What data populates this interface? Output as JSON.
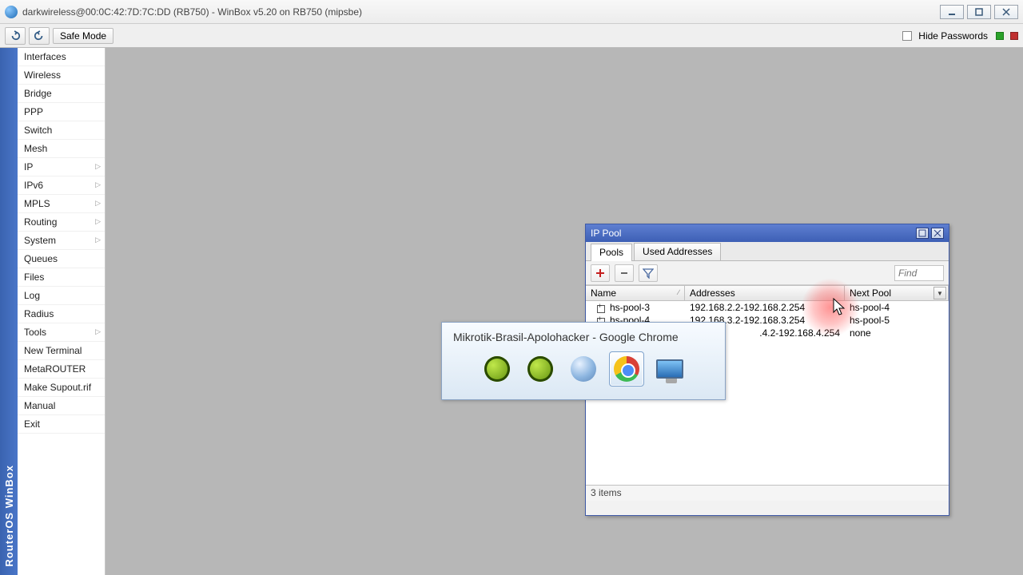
{
  "window": {
    "title": "darkwireless@00:0C:42:7D:7C:DD (RB750) - WinBox v5.20 on RB750 (mipsbe)"
  },
  "toolbar": {
    "safe_mode": "Safe Mode",
    "hide_pw": "Hide Passwords"
  },
  "vbar_label": "RouterOS WinBox",
  "sidebar": {
    "items": [
      {
        "label": "Interfaces",
        "sub": false
      },
      {
        "label": "Wireless",
        "sub": false
      },
      {
        "label": "Bridge",
        "sub": false
      },
      {
        "label": "PPP",
        "sub": false
      },
      {
        "label": "Switch",
        "sub": false
      },
      {
        "label": "Mesh",
        "sub": false
      },
      {
        "label": "IP",
        "sub": true
      },
      {
        "label": "IPv6",
        "sub": true
      },
      {
        "label": "MPLS",
        "sub": true
      },
      {
        "label": "Routing",
        "sub": true
      },
      {
        "label": "System",
        "sub": true
      },
      {
        "label": "Queues",
        "sub": false
      },
      {
        "label": "Files",
        "sub": false
      },
      {
        "label": "Log",
        "sub": false
      },
      {
        "label": "Radius",
        "sub": false
      },
      {
        "label": "Tools",
        "sub": true
      },
      {
        "label": "New Terminal",
        "sub": false
      },
      {
        "label": "MetaROUTER",
        "sub": false
      },
      {
        "label": "Make Supout.rif",
        "sub": false
      },
      {
        "label": "Manual",
        "sub": false
      },
      {
        "label": "Exit",
        "sub": false
      }
    ]
  },
  "ipwin": {
    "title": "IP Pool",
    "tabs": {
      "pools": "Pools",
      "used": "Used Addresses"
    },
    "find_placeholder": "Find",
    "columns": {
      "name": "Name",
      "addr": "Addresses",
      "next": "Next Pool"
    },
    "rows": [
      {
        "name": "hs-pool-3",
        "addr": "192.168.2.2-192.168.2.254",
        "next": "hs-pool-4"
      },
      {
        "name": "hs-pool-4",
        "addr": "192.168.3.2-192.168.3.254",
        "next": "hs-pool-5"
      },
      {
        "name": "",
        "addr": ".4.2-192.168.4.254",
        "next": "none"
      }
    ],
    "status": "3 items"
  },
  "alttab": {
    "title": "Mikrotik-Brasil-Apolohacker - Google Chrome"
  }
}
